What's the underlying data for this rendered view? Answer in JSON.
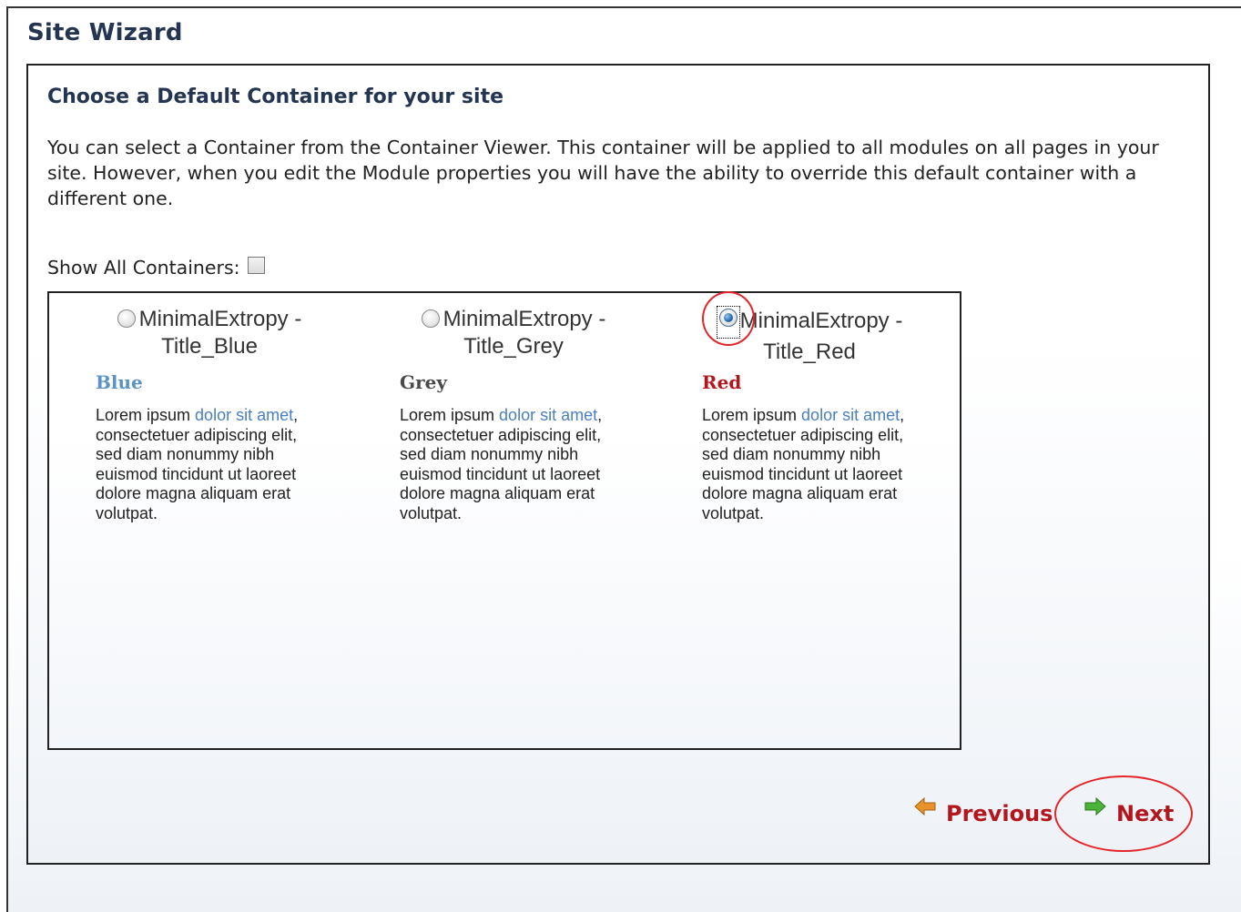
{
  "wizard": {
    "title": "Site Wizard"
  },
  "section": {
    "heading": "Choose a Default Container for your site",
    "description": "You can select a Container from the Container Viewer. This container will be applied to all modules on all pages in your site. However, when you edit the Module properties you will have the ability to override this default container with a different one."
  },
  "show_all": {
    "label": "Show All Containers:",
    "checked": false
  },
  "containers": [
    {
      "name_line1": "MinimalExtropy -",
      "name_line2": "Title_Blue",
      "selected": false,
      "color_label": "Blue",
      "color": "#5b93c7",
      "body_start": "Lorem ipsum ",
      "body_link": "dolor sit amet",
      "body_end": ", consectetuer adipiscing elit, sed diam nonummy nibh euismod tincidunt ut laoreet dolore magna aliquam erat volutpat."
    },
    {
      "name_line1": "MinimalExtropy -",
      "name_line2": "Title_Grey",
      "selected": false,
      "color_label": "Grey",
      "color": "#4a4a4a",
      "body_start": "Lorem ipsum ",
      "body_link": "dolor sit amet",
      "body_end": ", consectetuer adipiscing elit, sed diam nonummy nibh euismod tincidunt ut laoreet dolore magna aliquam erat volutpat."
    },
    {
      "name_line1": "MinimalExtropy -",
      "name_line2": "Title_Red",
      "selected": true,
      "color_label": "Red",
      "color": "#b3171d",
      "body_start": "Lorem ipsum ",
      "body_link": "dolor sit amet",
      "body_end": ", consectetuer adipiscing elit, sed diam nonummy nibh euismod tincidunt ut laoreet dolore magna aliquam erat volutpat."
    }
  ],
  "navigation": {
    "previous_label": "Previous",
    "previous_icon": "arrow-left-icon",
    "next_label": "Next",
    "next_icon": "arrow-right-icon"
  },
  "colors": {
    "heading": "#243552",
    "nav_text": "#b3171d",
    "annotation": "#e2262c",
    "previous_arrow": "#e8922a",
    "next_arrow": "#4bb33a",
    "link": "#4a7fbf"
  }
}
